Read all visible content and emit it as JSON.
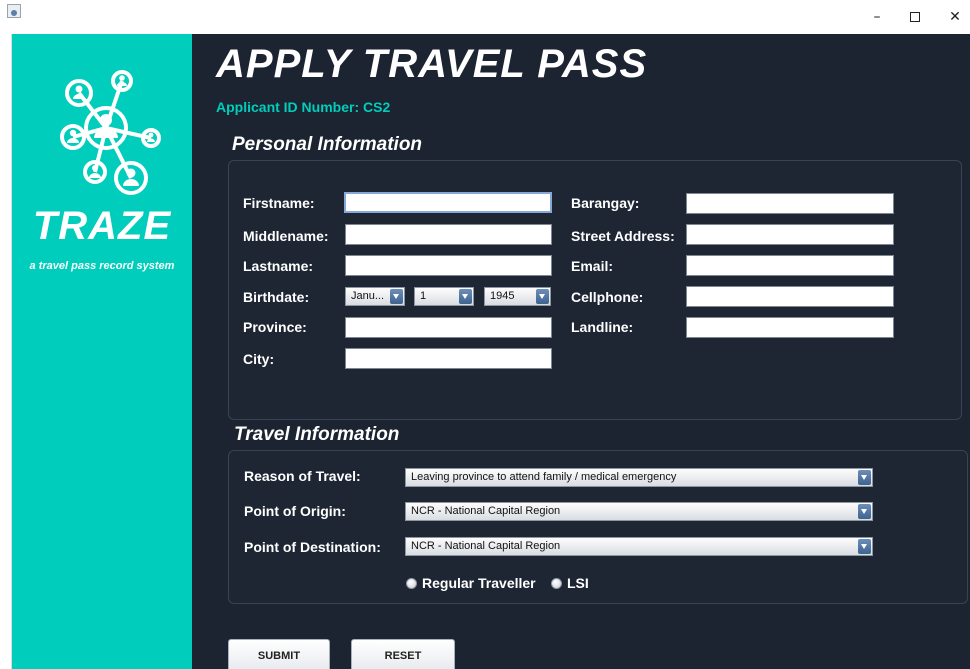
{
  "window": {
    "minimize": "–",
    "close": "✕"
  },
  "sidebar": {
    "brand": "TRAZE",
    "tagline": "a travel pass record system",
    "color": "#00cdbb"
  },
  "header": {
    "title": "APPLY TRAVEL PASS",
    "applicant_id": "Applicant ID Number: CS2"
  },
  "personal": {
    "title": "Personal Information",
    "fields": {
      "firstname": "Firstname:",
      "middlename": "Middlename:",
      "lastname": "Lastname:",
      "birthdate": "Birthdate:",
      "province": "Province:",
      "city": "City:",
      "barangay": "Barangay:",
      "street": "Street Address:",
      "email": "Email:",
      "cellphone": "Cellphone:",
      "landline": "Landline:"
    },
    "birth_month": "Janu...",
    "birth_day": "1",
    "birth_year": "1945"
  },
  "travel": {
    "title": "Travel Information",
    "reason_label": "Reason of Travel:",
    "reason_value": "Leaving province to attend family / medical emergency",
    "origin_label": "Point of Origin:",
    "origin_value": "NCR - National Capital Region",
    "destination_label": "Point of Destination:",
    "destination_value": "NCR - National Capital Region",
    "radio_regular": "Regular Traveller",
    "radio_lsi": "LSI"
  },
  "buttons": {
    "submit": "SUBMIT",
    "reset": "RESET"
  },
  "colors": {
    "accent": "#00cdbb",
    "main_bg": "#1c2431"
  },
  "icons": {
    "app": "java-app-icon",
    "logo": "network-people-logo"
  }
}
